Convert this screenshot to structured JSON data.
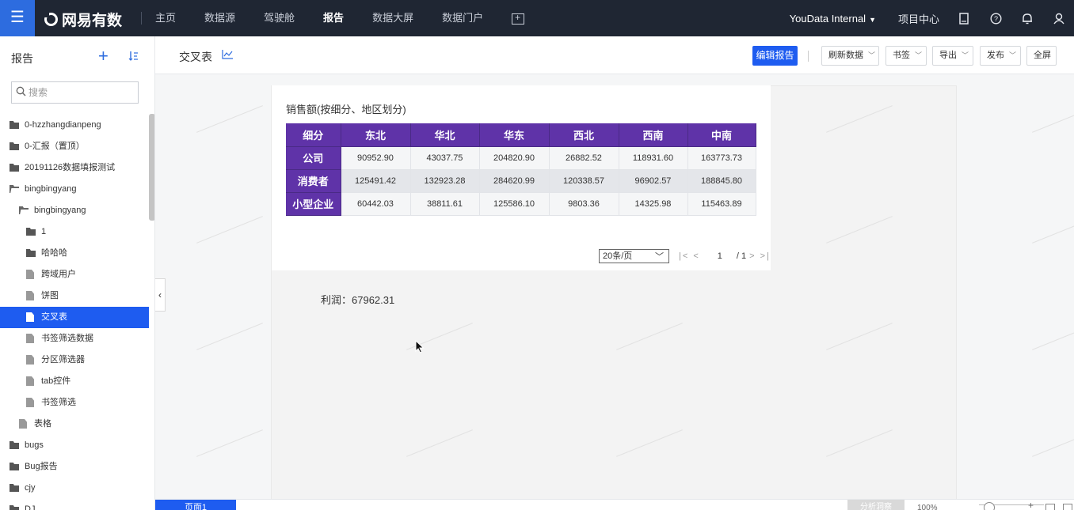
{
  "topbar": {
    "brand": "网易有数",
    "nav": [
      "主页",
      "数据源",
      "驾驶舱",
      "报告",
      "数据大屏",
      "数据门户"
    ],
    "active_nav_index": 3,
    "org": "YouData Internal",
    "project_center": "项目中心"
  },
  "sidebar": {
    "title": "报告",
    "search_placeholder": "搜索",
    "items": [
      {
        "label": "0-hzzhangdianpeng",
        "type": "folder",
        "level": 0
      },
      {
        "label": "0-汇报（置顶）",
        "type": "folder",
        "level": 0
      },
      {
        "label": "20191126数据填报测试",
        "type": "folder",
        "level": 0
      },
      {
        "label": "bingbingyang",
        "type": "folder-open",
        "level": 0
      },
      {
        "label": "bingbingyang",
        "type": "folder-open",
        "level": 1
      },
      {
        "label": "1",
        "type": "folder",
        "level": 2
      },
      {
        "label": "哈哈哈",
        "type": "folder",
        "level": 2
      },
      {
        "label": "跨域用户",
        "type": "report",
        "level": 2
      },
      {
        "label": "饼图",
        "type": "report",
        "level": 2
      },
      {
        "label": "交叉表",
        "type": "report",
        "level": 2,
        "selected": true
      },
      {
        "label": "书签筛选数据",
        "type": "report",
        "level": 2
      },
      {
        "label": "分区筛选器",
        "type": "report",
        "level": 2
      },
      {
        "label": "tab控件",
        "type": "report",
        "level": 2
      },
      {
        "label": "书签筛选",
        "type": "report",
        "level": 2
      },
      {
        "label": "表格",
        "type": "report",
        "level": 1
      },
      {
        "label": "bugs",
        "type": "folder",
        "level": 0
      },
      {
        "label": "Bug报告",
        "type": "folder",
        "level": 0
      },
      {
        "label": "cjy",
        "type": "folder",
        "level": 0
      },
      {
        "label": "DJ",
        "type": "folder",
        "level": 0
      }
    ]
  },
  "toolbar": {
    "report_title": "交叉表",
    "edit_report": "编辑报告",
    "refresh": "刷新数据",
    "bookmark": "书签",
    "export": "导出",
    "publish": "发布",
    "fullscreen": "全屏"
  },
  "crosstab": {
    "title": "销售额(按细分、地区划分)",
    "corner": "细分",
    "columns": [
      "东北",
      "华北",
      "华东",
      "西北",
      "西南",
      "中南"
    ],
    "rows": [
      {
        "label": "公司",
        "values": [
          "90952.90",
          "43037.75",
          "204820.90",
          "26882.52",
          "118931.60",
          "163773.73"
        ]
      },
      {
        "label": "消费者",
        "values": [
          "125491.42",
          "132923.28",
          "284620.99",
          "120338.57",
          "96902.57",
          "188845.80"
        ]
      },
      {
        "label": "小型企业",
        "values": [
          "60442.03",
          "38811.61",
          "125586.10",
          "9803.36",
          "14325.98",
          "115463.89"
        ]
      }
    ],
    "header_color": "#5f33a8"
  },
  "pager": {
    "page_size": "20条/页",
    "current_page": "1",
    "total_pages": "/ 1"
  },
  "profit": {
    "text": "利润：67962.31"
  },
  "bottombar": {
    "page_tab": "页面1",
    "analysis_button": "分析洞察",
    "zoom": "100%"
  },
  "colors": {
    "accent": "#1e5cf0",
    "topbar": "#1f2633"
  }
}
